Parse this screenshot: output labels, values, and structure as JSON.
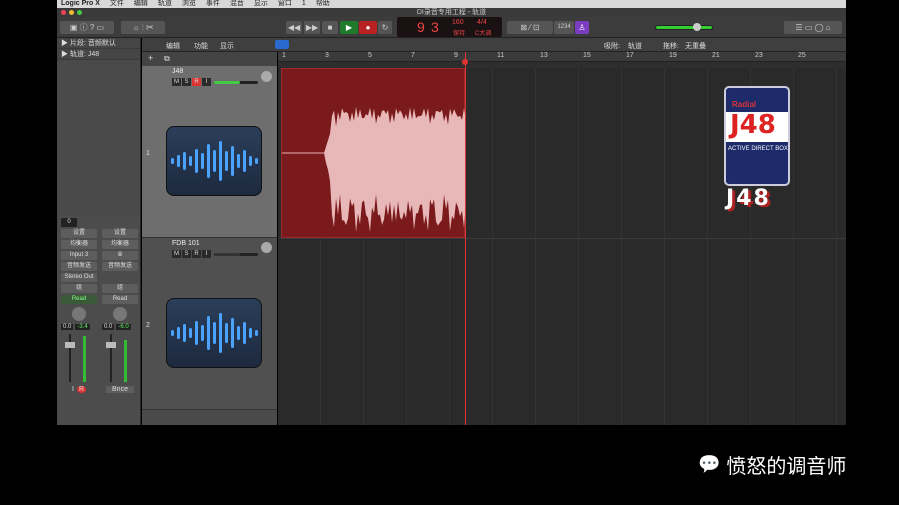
{
  "menubar": {
    "items": [
      "Logic Pro X",
      "文件",
      "编辑",
      "轨道",
      "浏览",
      "事件",
      "混音",
      "显示",
      "窗口",
      "1",
      "帮助"
    ]
  },
  "window": {
    "title": "DI录音专用工程 - 轨道"
  },
  "lcd": {
    "bar": "9",
    "beat": "3",
    "tempo": "160",
    "tempo_label": "保持",
    "signature": "4/4",
    "key": "C大调"
  },
  "toolbar": {
    "cpu_label": "1234"
  },
  "inspector": {
    "region_label": "▶ 片段: 音频默认",
    "track_label": "▶ 轨道:  J48",
    "strips": [
      {
        "gain": "0",
        "setting": "设置",
        "eq": "均衡器",
        "input": "Input 3",
        "sends": "音频发送",
        "output": "Stereo Out",
        "group": "组",
        "automation": "Read",
        "pan_value": "0.0",
        "peak": "-3.4",
        "name": "I",
        "rec": "R"
      },
      {
        "setting": "设置",
        "eq": "均衡器",
        "input": "⦾",
        "sends": "音频发送",
        "group": "组",
        "automation": "Read",
        "pan_value": "0.0",
        "peak": "-6.0",
        "name": "Bnce"
      }
    ]
  },
  "track_toolbar": {
    "edit": "编辑",
    "functions": "功能",
    "view": "显示",
    "snap_label": "吸附:",
    "snap_value": "轨道",
    "drag_label": "拖移:",
    "drag_value": "无重叠"
  },
  "ruler": {
    "marks": [
      "1",
      "3",
      "5",
      "7",
      "9",
      "11",
      "13",
      "15",
      "17",
      "19",
      "21",
      "23",
      "25"
    ]
  },
  "tracks": [
    {
      "number": "1",
      "name": "J48",
      "buttons": [
        "M",
        "S",
        "R",
        "I"
      ],
      "volume": 0.6
    },
    {
      "number": "2",
      "name": "FDB 101",
      "buttons": [
        "M",
        "S",
        "R",
        "I"
      ],
      "volume": 0.6
    }
  ],
  "overlay": {
    "product": "J48",
    "brand": "Radial",
    "subtitle": "ACTIVE DIRECT BOX"
  },
  "watermark": {
    "text": "愤怒的调音师"
  }
}
